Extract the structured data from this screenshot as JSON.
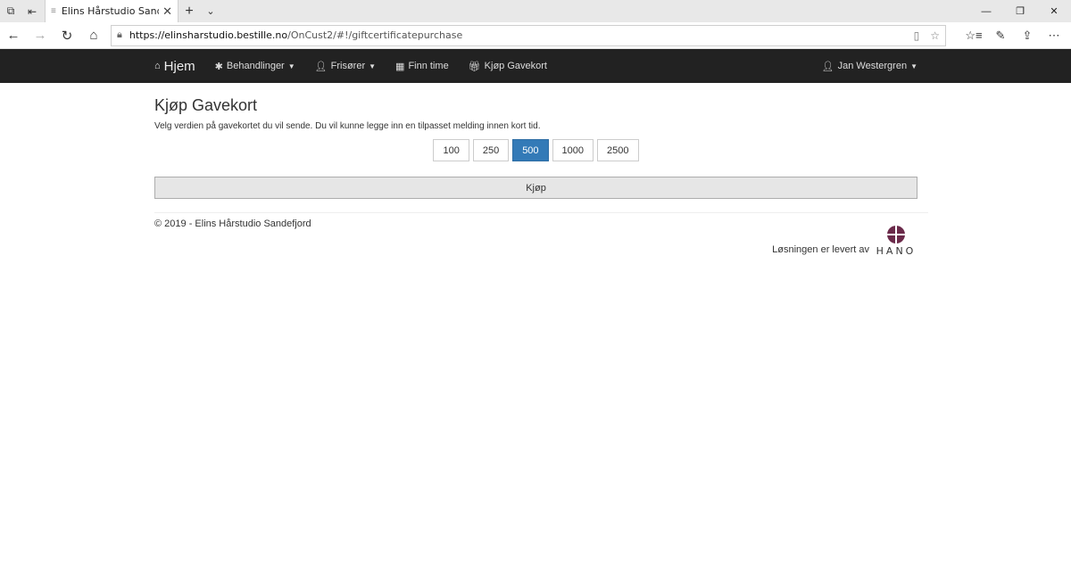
{
  "browser": {
    "tab_title": "Elins Hårstudio Sandefjc",
    "url_host": "https://elinsharstudio.bestille.no",
    "url_path": "/OnCust2/#!/giftcertificatepurchase"
  },
  "nav": {
    "brand": "Hjem",
    "items": [
      {
        "label": "Behandlinger",
        "icon": "asterisk-icon",
        "dropdown": true
      },
      {
        "label": "Frisører",
        "icon": "user-plus-icon",
        "dropdown": true
      },
      {
        "label": "Finn time",
        "icon": "calendar-icon",
        "dropdown": false
      },
      {
        "label": "Kjøp Gavekort",
        "icon": "gift-icon",
        "dropdown": false
      }
    ],
    "user": "Jan Westergren"
  },
  "page": {
    "title": "Kjøp Gavekort",
    "description": "Velg verdien på gavekortet du vil sende. Du vil kunne legge inn en tilpasset melding innen kort tid.",
    "values": [
      "100",
      "250",
      "500",
      "1000",
      "2500"
    ],
    "selected_value": "500",
    "buy_label": "Kjøp"
  },
  "footer": {
    "copyright": "© 2019 - Elins Hårstudio Sandefjord",
    "provider_text": "Løsningen er levert av",
    "logo_text": "HANO"
  },
  "colors": {
    "navbar": "#222222",
    "selected": "#337ab7",
    "logo": "#6b2a4a"
  }
}
